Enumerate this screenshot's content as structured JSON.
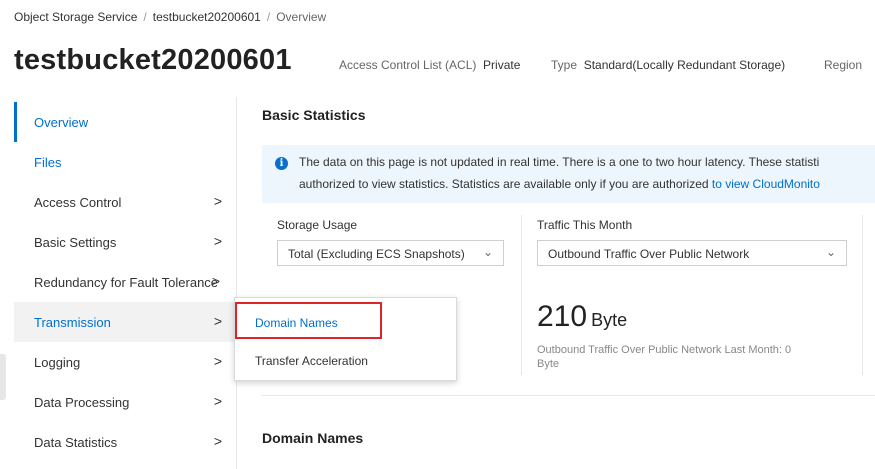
{
  "breadcrumb": {
    "items": [
      "Object Storage Service",
      "testbucket20200601",
      "Overview"
    ],
    "separator": "/"
  },
  "header": {
    "title": "testbucket20200601",
    "acl_label": "Access Control List (ACL)",
    "acl_value": "Private",
    "type_label": "Type",
    "type_value": "Standard(Locally Redundant Storage)",
    "region_label": "Region"
  },
  "sidebar": {
    "items": [
      {
        "label": "Overview",
        "chevron": ""
      },
      {
        "label": "Files",
        "chevron": ""
      },
      {
        "label": "Access Control",
        "chevron": ">"
      },
      {
        "label": "Basic Settings",
        "chevron": ">"
      },
      {
        "label": "Redundancy for Fault Tolerance",
        "chevron": ">"
      },
      {
        "label": "Transmission",
        "chevron": ">"
      },
      {
        "label": "Logging",
        "chevron": ">"
      },
      {
        "label": "Data Processing",
        "chevron": ">"
      },
      {
        "label": "Data Statistics",
        "chevron": ">"
      }
    ]
  },
  "main": {
    "basic_statistics_title": "Basic Statistics",
    "notice": {
      "line1": "The data on this page is not updated in real time. There is a one to two hour latency. These statisti",
      "line2_prefix": "authorized to view statistics. Statistics are available only if you are authorized ",
      "line2_link": "to view CloudMonito"
    },
    "storage_usage": {
      "label": "Storage Usage",
      "select_value": "Total (Excluding ECS Snapshots)"
    },
    "traffic": {
      "label": "Traffic This Month",
      "select_value": "Outbound Traffic Over Public Network",
      "value": "210",
      "unit": "Byte",
      "note_line1": "Outbound Traffic Over Public Network Last Month: 0",
      "note_line2": "Byte"
    },
    "domain_names_title": "Domain Names"
  },
  "transmission_menu": {
    "items": [
      "Domain Names",
      "Transfer Acceleration"
    ]
  },
  "colors": {
    "accent": "#0070cc",
    "highlight_border": "#e0232b",
    "notice_bg": "#edf5fd"
  },
  "icons": {
    "info": "info-icon",
    "chevron": "chevron-right-icon",
    "caret": "chevron-down-icon"
  }
}
